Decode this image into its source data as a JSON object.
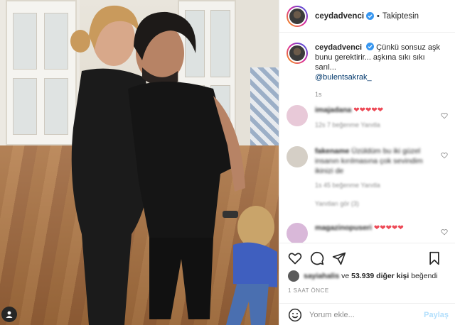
{
  "header": {
    "username": "ceydadvenci",
    "separator": "•",
    "follow_status": "Takiptesin"
  },
  "caption": {
    "username": "ceydadvenci",
    "text": "Çünkü sonsuz aşk bunu gerektirir... aşkına sıkı sıkı sarıl...",
    "mention": "@bulentsakrak_",
    "time": "1s"
  },
  "comments": [
    {
      "username": "imajadana",
      "text": "❤❤❤❤❤",
      "meta": "12s  7 beğenme  Yanıtla"
    },
    {
      "username": "fakename",
      "text": "Üzüldüm bu iki güzel insanın kırılmasına çok sevindim ikinizi de",
      "meta": "1s  45 beğenme  Yanıtla",
      "replies": "Yanıtları gör (3)"
    },
    {
      "username": "magazinopuseri",
      "text": "❤❤❤❤❤",
      "meta": ""
    }
  ],
  "likes": {
    "first_user": "sayiahalis",
    "connector": "ve",
    "count_text": "53.939 diğer kişi",
    "suffix": "beğendi"
  },
  "post_time": "1 SAAT ÖNCE",
  "comment_input": {
    "placeholder": "Yorum ekle...",
    "post_label": "Paylaş"
  },
  "colors": {
    "verified": "#3897f0",
    "heart": "#ed4956",
    "link": "#00376b",
    "post_disabled": "#b2dffc"
  },
  "icons": [
    "heart-icon",
    "comment-icon",
    "share-icon",
    "bookmark-icon",
    "emoji-icon",
    "verified-badge-icon",
    "user-tag-icon"
  ]
}
